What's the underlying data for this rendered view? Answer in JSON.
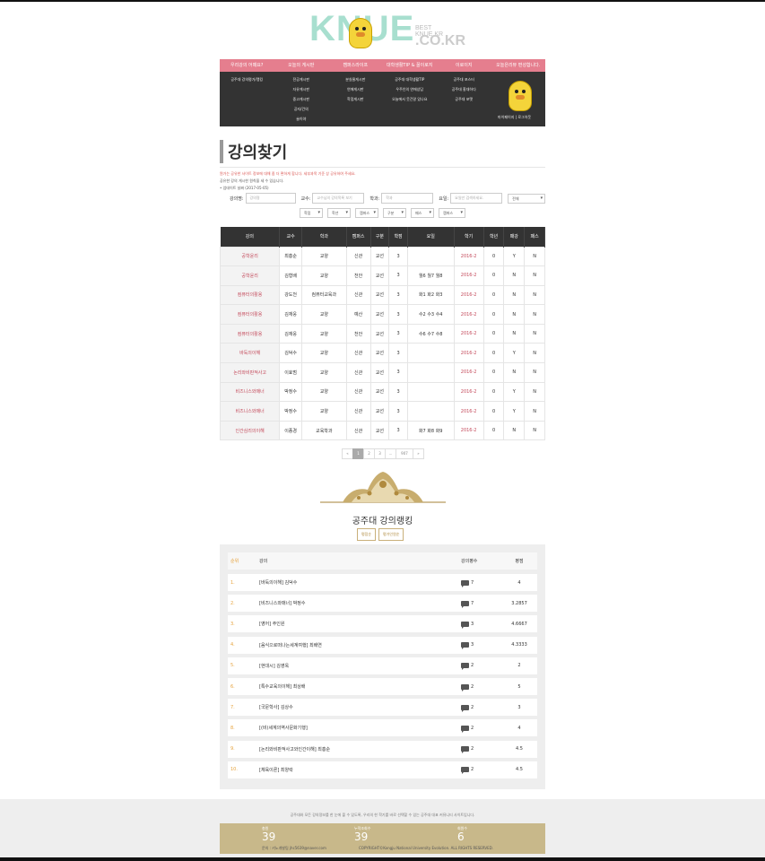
{
  "logo": {
    "text": "KNUE",
    "sub": "BEST KNUE.KR",
    "domain": ".CO.KR"
  },
  "nav": {
    "top": [
      "우리강의 어때요?",
      "오늘의 게시판",
      "캠퍼스라이프",
      "대학생활TIP & 꿀이로지",
      "이로이지",
      "오늘은리뷰 편성합니다."
    ],
    "cols": [
      [
        "공주대 강의평가/랭킹"
      ],
      [
        "전공게시판",
        "자유게시판",
        "중고게시판",
        "공지/건의",
        "술이야"
      ],
      [
        "분실물게시판",
        "연애게시판",
        "학점게시판"
      ],
      [
        "공주대 대학생활TIP",
        "우주인의 연애상담",
        "오늘에서 웃긴말 있나요"
      ],
      [
        "공주대 포스터",
        "공주대 홍대하다",
        "공주대 포맷"
      ],
      []
    ],
    "links": [
      "마이페이지",
      "로그아웃"
    ]
  },
  "page_title": "강의찾기",
  "notice": {
    "line1": "뭔가는 공유한 사이트 정보에 대해 좀 더 편하게 합니다. 세부과목 기준 상 공유하여 주세요.",
    "line2": "공유한 강의 게시한 원칙을 세 수 있습니다.",
    "line3": "• 업데이트 날짜 (2017-05-05)"
  },
  "filters": {
    "lecture_label": "강의명:",
    "lecture_ph": "강의명",
    "prof_label": "교수:",
    "prof_ph": "교수님의 강의목록 보기",
    "dept_label": "학과:",
    "dept_ph": "학과",
    "day_label": "요일:",
    "day_ph": "요일만 검색하세요.",
    "sel_all": "전체",
    "row2": [
      "학점",
      "학년",
      "캠퍼스",
      "구분",
      "패스",
      "캠퍼스"
    ]
  },
  "table": {
    "headers": [
      "강의",
      "교수",
      "학과",
      "캠퍼스",
      "구분",
      "학점",
      "요일",
      "학기",
      "학년",
      "패강",
      "패스"
    ],
    "rows": [
      [
        "공학윤리",
        "최흥순",
        "교양",
        "신관",
        "교선",
        "3",
        "",
        "2016-2",
        "0",
        "Y",
        "N"
      ],
      [
        "공학윤리",
        "김형배",
        "교양",
        "천안",
        "교선",
        "3",
        "월6 월7 월8",
        "2016-2",
        "0",
        "N",
        "N"
      ],
      [
        "컴퓨터의활용",
        "강도천",
        "컴퓨터교육과",
        "신관",
        "교선",
        "3",
        "화1 화2 화3",
        "2016-2",
        "0",
        "N",
        "N"
      ],
      [
        "컴퓨터의활용",
        "김재웅",
        "교양",
        "예산",
        "교선",
        "3",
        "수2 수3 수4",
        "2016-2",
        "0",
        "N",
        "N"
      ],
      [
        "컴퓨터의활용",
        "김재웅",
        "교양",
        "천안",
        "교선",
        "3",
        "수6 수7 수8",
        "2016-2",
        "0",
        "N",
        "N"
      ],
      [
        "바둑의이해",
        "김덕수",
        "교양",
        "신관",
        "교선",
        "3",
        "",
        "2016-2",
        "0",
        "Y",
        "N"
      ],
      [
        "논리와비판적사고",
        "이효범",
        "교양",
        "신관",
        "교선",
        "3",
        "",
        "2016-2",
        "0",
        "N",
        "N"
      ],
      [
        "비즈니스와매너",
        "박정수",
        "교양",
        "신관",
        "교선",
        "3",
        "",
        "2016-2",
        "0",
        "Y",
        "N"
      ],
      [
        "비즈니스와매너",
        "박정수",
        "교양",
        "신관",
        "교선",
        "3",
        "",
        "2016-2",
        "0",
        "Y",
        "N"
      ],
      [
        "인간심리의이해",
        "이종경",
        "교육학과",
        "신관",
        "교선",
        "3",
        "화7 화8 화9",
        "2016-2",
        "0",
        "N",
        "N"
      ]
    ]
  },
  "pager": [
    "«",
    "1",
    "2",
    "3",
    "...",
    "907",
    "»"
  ],
  "ranking": {
    "title": "공주대 강의랭킹",
    "tabs": [
      "평점순",
      "평가인원순"
    ],
    "head": {
      "num": "순위",
      "name": "강의",
      "count": "강의평수",
      "score": "평점"
    },
    "rows": [
      {
        "num": "1.",
        "name": "[바둑의이해] 김덕수",
        "count": "7",
        "score": "4"
      },
      {
        "num": "2.",
        "name": "[비즈니스와매너] 박정수",
        "count": "7",
        "score": "3.2857"
      },
      {
        "num": "3.",
        "name": "[영어] 주인원",
        "count": "3",
        "score": "4.6667"
      },
      {
        "num": "4.",
        "name": "[음식으로떠나는세계여행] 최배연",
        "count": "3",
        "score": "4.3333"
      },
      {
        "num": "5.",
        "name": "[현대시] 김영옥",
        "count": "2",
        "score": "2"
      },
      {
        "num": "6.",
        "name": "[특수교육의이해] 최상배",
        "count": "2",
        "score": "5"
      },
      {
        "num": "7.",
        "name": "[국문학사] 김상수",
        "count": "2",
        "score": "3"
      },
      {
        "num": "8.",
        "name": "[(비)세계의역사문화기행]",
        "count": "2",
        "score": "4"
      },
      {
        "num": "9.",
        "name": "[논리와비판적사고와인간이해] 최흥순",
        "count": "2",
        "score": "4.5"
      },
      {
        "num": "10.",
        "name": "[체육이론] 최양락",
        "count": "2",
        "score": "4.5"
      }
    ]
  },
  "footer": {
    "message": "공주대와 모든 강의정보를 한 눈에 볼 수 있도록, 우리의 한 학기를 바로 선택할 수 있는 공주대 대표 커뮤니티 사이트입니다.",
    "stats": [
      {
        "label": "총원",
        "value": "39"
      },
      {
        "label": "누적조회수",
        "value": "39"
      },
      {
        "label": "회원수",
        "value": "6"
      }
    ],
    "contact": "문의 : 키노개발팀 jhc5639@naver.com",
    "copyright": "COPYRIGHT©Kongju National University Evolution. ALL RIGHTS RESERVED."
  },
  "colors": {
    "accent_pink": "#e57e8e",
    "nav_dark": "#333333",
    "lecture_red": "#c4495a",
    "gold": "#c8b88a",
    "logo_mint": "#a8dfcf"
  }
}
